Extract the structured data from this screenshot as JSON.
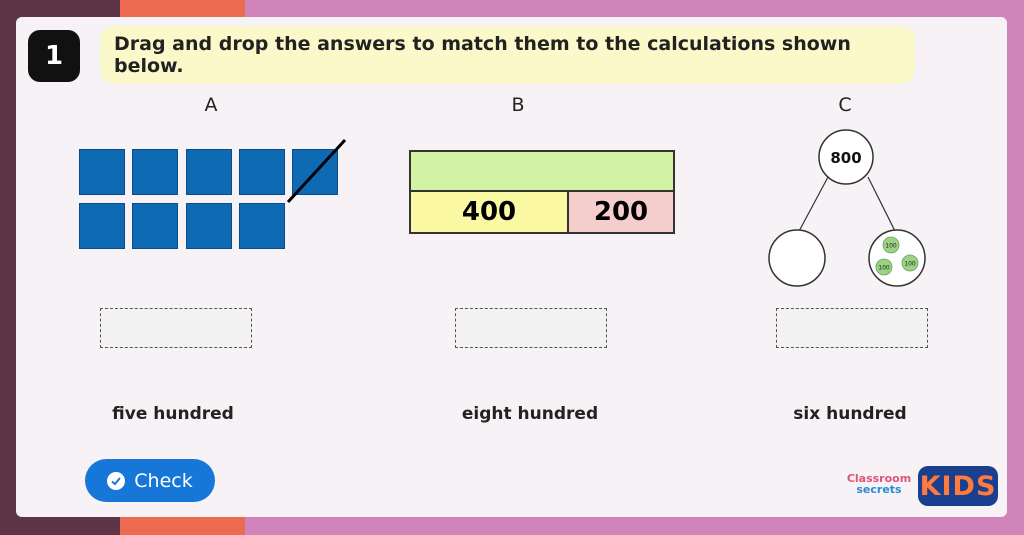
{
  "question": {
    "number": "1",
    "instruction": "Drag and drop the answers to match them to the calculations shown below."
  },
  "columns": {
    "a": {
      "label": "A",
      "squares_total": 10,
      "squares_crossed": 1
    },
    "b": {
      "label": "B",
      "top_value": "",
      "part_1": "400",
      "part_2": "200"
    },
    "c": {
      "label": "C",
      "whole": "800",
      "counters": [
        "100",
        "100",
        "100"
      ]
    }
  },
  "answers": [
    "five hundred",
    "eight hundred",
    "six hundred"
  ],
  "check_button": {
    "label": "Check"
  },
  "logo": {
    "line1": "Classroom",
    "line2": "secrets",
    "kids": "KIDS"
  },
  "colors": {
    "square_blue": "#0f6ab4",
    "bar_green": "#d2f3a3",
    "bar_yellow": "#fbf8a3",
    "bar_pink": "#f6cdcd",
    "counter_green": "#9bd386",
    "button_blue": "#1677d9"
  }
}
